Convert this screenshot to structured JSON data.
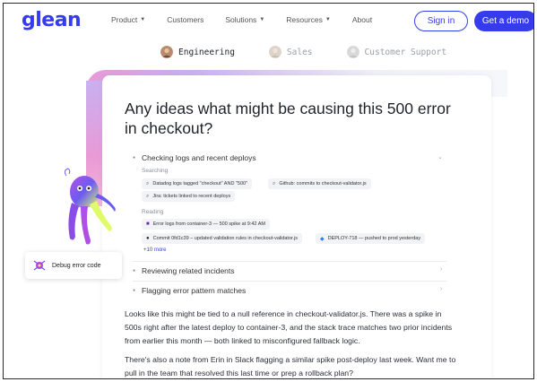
{
  "nav": {
    "logo": "glean",
    "links": [
      {
        "label": "Product",
        "caret": true
      },
      {
        "label": "Customers",
        "caret": false
      },
      {
        "label": "Solutions",
        "caret": true
      },
      {
        "label": "Resources",
        "caret": true
      },
      {
        "label": "About",
        "caret": false
      }
    ],
    "sign_in": "Sign in",
    "get_demo": "Get a demo"
  },
  "tabs": [
    {
      "label": "Engineering",
      "active": true
    },
    {
      "label": "Sales",
      "active": false
    },
    {
      "label": "Customer Support",
      "active": false
    }
  ],
  "question": "Any ideas what might be causing this 500 error in checkout?",
  "sections": {
    "checking": {
      "title": "Checking logs and recent deploys",
      "searching_label": "Searching",
      "searching_chips": [
        "Datadog logs tagged \"checkout\" AND \"500\"",
        "Github: commits to checkout-validator.js",
        "Jira: tickets linked to recent deploys"
      ],
      "reading_label": "Reading",
      "reading_chips": [
        "Error logs from container-3 — 500 spike at 9:42 AM",
        "Commit 0fd1c39 – updated validation rules in checkout-validator.js",
        "DEPLOY-718 — pushed to prod yesterday"
      ],
      "more": "+10 more"
    },
    "reviewing": "Reviewing related incidents",
    "flagging": "Flagging error pattern matches"
  },
  "answer": {
    "p1": "Looks like this might be tied to a null reference in checkout-validator.js. There was a spike in 500s right after the latest deploy to container-3, and the stack trace matches two prior incidents from earlier this month — both linked to misconfigured fallback logic.",
    "p2": "There's also a note from Erin in Slack flagging a similar spike post-deploy last week. Want me to pull in the team that resolved this last time or prep a rollback plan?"
  },
  "debug_card": {
    "label": "Debug error code"
  },
  "colors": {
    "brand": "#343ced",
    "ribbon_pink": "#e99ad6",
    "ribbon_purple": "#c9b0f2"
  }
}
